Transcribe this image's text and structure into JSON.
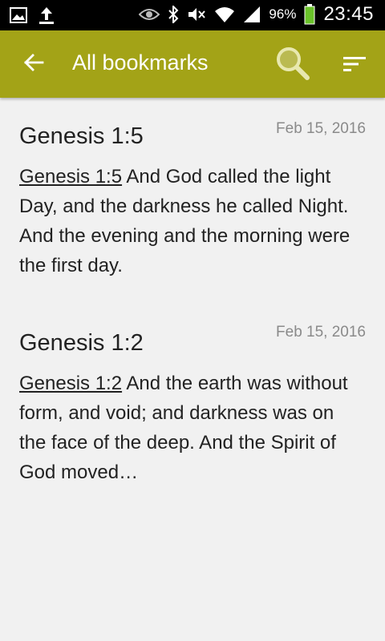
{
  "status_bar": {
    "left_icons": [
      "image-icon",
      "upload-icon"
    ],
    "right_icons": [
      "eye-icon",
      "bluetooth-icon",
      "mute-icon",
      "wifi-icon",
      "signal-icon",
      "battery-icon"
    ],
    "battery_percent": "96%",
    "time": "23:45"
  },
  "app_bar": {
    "title": "All bookmarks",
    "color": "#a3a317"
  },
  "bookmarks": [
    {
      "reference": "Genesis 1:5",
      "date": "Feb 15, 2016",
      "link": "Genesis 1:5",
      "text": " And God called the light Day, and the darkness he called Night. And the evening and the morning were the first day."
    },
    {
      "reference": "Genesis 1:2",
      "date": "Feb 15, 2016",
      "link": "Genesis 1:2",
      "text": " And the earth was without form, and void; and darkness was on the face of the deep. And the Spirit of God moved…"
    }
  ]
}
